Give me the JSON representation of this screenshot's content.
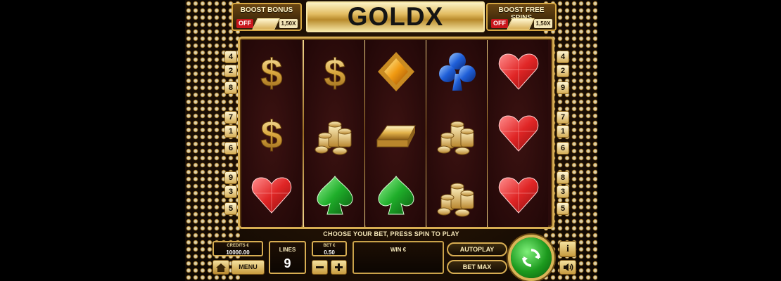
{
  "header": {
    "logo": "GOLDX",
    "boost_bonus": {
      "title": "BOOST BONUS",
      "state": "OFF",
      "multiplier": "1,50X"
    },
    "boost_free_spins": {
      "title": "BOOST FREE SPINS",
      "state": "OFF",
      "multiplier": "1,50X"
    }
  },
  "reels": [
    [
      "dollar",
      "dollar",
      "heart"
    ],
    [
      "dollar",
      "coins",
      "spade"
    ],
    [
      "diamond",
      "gold-bar",
      "spade"
    ],
    [
      "club",
      "coins",
      "coins"
    ],
    [
      "heart",
      "heart",
      "heart"
    ]
  ],
  "line_markers": {
    "left": [
      "4",
      "2",
      "8",
      "7",
      "1",
      "6",
      "9",
      "3",
      "5"
    ],
    "right": [
      "4",
      "2",
      "9",
      "7",
      "1",
      "6",
      "8",
      "3",
      "5"
    ]
  },
  "prompt": "CHOOSE YOUR BET, PRESS SPIN TO PLAY",
  "credits": {
    "label": "CREDITS €",
    "value": "10000.00"
  },
  "menu_label": "MENU",
  "lines": {
    "label": "LINES",
    "value": "9"
  },
  "bet": {
    "label": "BET €",
    "value": "0.50"
  },
  "win": {
    "label": "WIN €"
  },
  "autoplay_label": "AUTOPLAY",
  "bet_max_label": "BET MAX",
  "info_label": "i",
  "colors": {
    "gold": "#d7ad52",
    "reel_bg": "#2a0b0b",
    "spin_green": "#1c9a1e",
    "off_red": "#c8161c"
  }
}
